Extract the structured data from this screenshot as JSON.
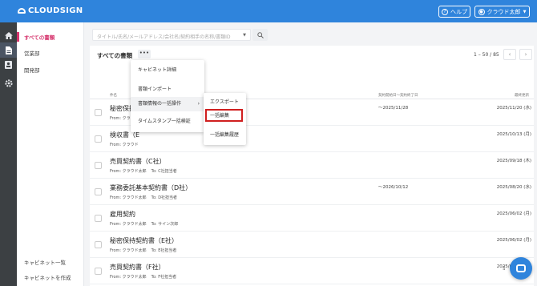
{
  "header": {
    "logo": "CLOUDSIGN",
    "help_label": "ヘルプ",
    "user_label": "クラウド太郎",
    "accent": "#2f84dc"
  },
  "rail": {
    "icons": [
      "home-icon",
      "document-icon",
      "contact-card-icon",
      "gear-icon"
    ]
  },
  "sidebar": {
    "items": [
      {
        "label": "すべての書類"
      },
      {
        "label": "営業部"
      },
      {
        "label": "開発部"
      }
    ],
    "bottom": [
      {
        "label": "キャビネット一覧"
      },
      {
        "label": "キャビネットを作成"
      }
    ]
  },
  "search": {
    "placeholder": "タイトル/氏名/メールアドレス/会社名/契約相手の名称/書類ID"
  },
  "list": {
    "title": "すべての書類",
    "more_label": "•••",
    "pager": "1 – 50 / 85",
    "prev": "‹",
    "next": "›",
    "columns": {
      "name": "件名",
      "period": "契約開始日〜契約終了日",
      "updated": "最終更新"
    },
    "rows": [
      {
        "title": "秘密保持契",
        "from": "From: クラウド",
        "to": "",
        "period": "〜2025/11/28",
        "date": "2025/11/20 (水)"
      },
      {
        "title": "検収書（E",
        "from": "From: クラウド",
        "to": "",
        "period": "",
        "date": "2025/10/13 (月)"
      },
      {
        "title": "売買契約書（C社）",
        "from": "From: クラウド太郎",
        "to": "To: C社担当者",
        "period": "",
        "date": "2025/09/18 (木)"
      },
      {
        "title": "業務委託基本契約書（D社）",
        "from": "From: クラウド太郎",
        "to": "To: D社担当者",
        "period": "〜2026/10/12",
        "date": "2025/08/20 (水)"
      },
      {
        "title": "雇用契約",
        "from": "From: クラウド太郎",
        "to": "To: サイン次郎",
        "period": "",
        "date": "2025/06/02 (月)"
      },
      {
        "title": "秘密保持契約書（E社）",
        "from": "From: クラウド太郎",
        "to": "To: E社担当者",
        "period": "",
        "date": "2025/06/02 (月)"
      },
      {
        "title": "売買契約書（F社）",
        "from": "From: クラウド太郎",
        "to": "To: F社担当者",
        "period": "",
        "date": "2025/06/02 (月)"
      }
    ]
  },
  "menu": {
    "items": [
      {
        "label": "キャビネット詳細"
      },
      {
        "label": "書類インポート"
      },
      {
        "label": "書類情報の一括操作"
      },
      {
        "label": "タイムスタンプ一括検証"
      }
    ],
    "arrow": "›"
  },
  "submenu": {
    "items": [
      {
        "label": "エクスポート"
      },
      {
        "label": "一括編集"
      },
      {
        "label": "一括編集履歴"
      }
    ]
  },
  "highlight_color": "#d01f1f"
}
